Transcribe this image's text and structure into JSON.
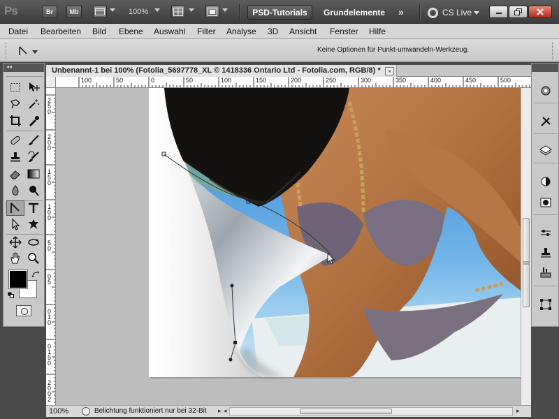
{
  "appbar": {
    "logo": "Ps",
    "bridge": "Br",
    "minibridge": "Mb",
    "zoom": "100%",
    "workspace_active": "PSD-Tutorials",
    "workspace_item": "Grundelemente",
    "more": "»",
    "cslive": "CS Live"
  },
  "menu": [
    "Datei",
    "Bearbeiten",
    "Bild",
    "Ebene",
    "Auswahl",
    "Filter",
    "Analyse",
    "3D",
    "Ansicht",
    "Fenster",
    "Hilfe"
  ],
  "options": {
    "hint": "Keine Optionen für Punkt-umwandeln-Werkzeug."
  },
  "document": {
    "tab_title": "Unbenannt-1 bei 100% (Fotolia_5697778_XL © 1418336 Ontario Ltd - Fotolia.com, RGB/8) *",
    "close": "×",
    "ruler_top": [
      "100",
      "50",
      "0",
      "50",
      "100",
      "150",
      "200",
      "250",
      "300",
      "350",
      "400",
      "450",
      "500"
    ],
    "ruler_left": [
      "2",
      "5",
      "0",
      "2",
      "0",
      "0",
      "1",
      "5",
      "0",
      "1",
      "0",
      "0",
      "5",
      "0",
      "0",
      "5",
      "0",
      "1",
      "0",
      "0",
      "1",
      "5",
      "0",
      "2",
      "0",
      "0",
      "2",
      "5",
      "0"
    ]
  },
  "status": {
    "zoom": "100%",
    "info": "Belichtung funktioniert nur bei 32-Bit"
  },
  "colors": {
    "foreground": "#000000",
    "background": "#ffffff"
  }
}
